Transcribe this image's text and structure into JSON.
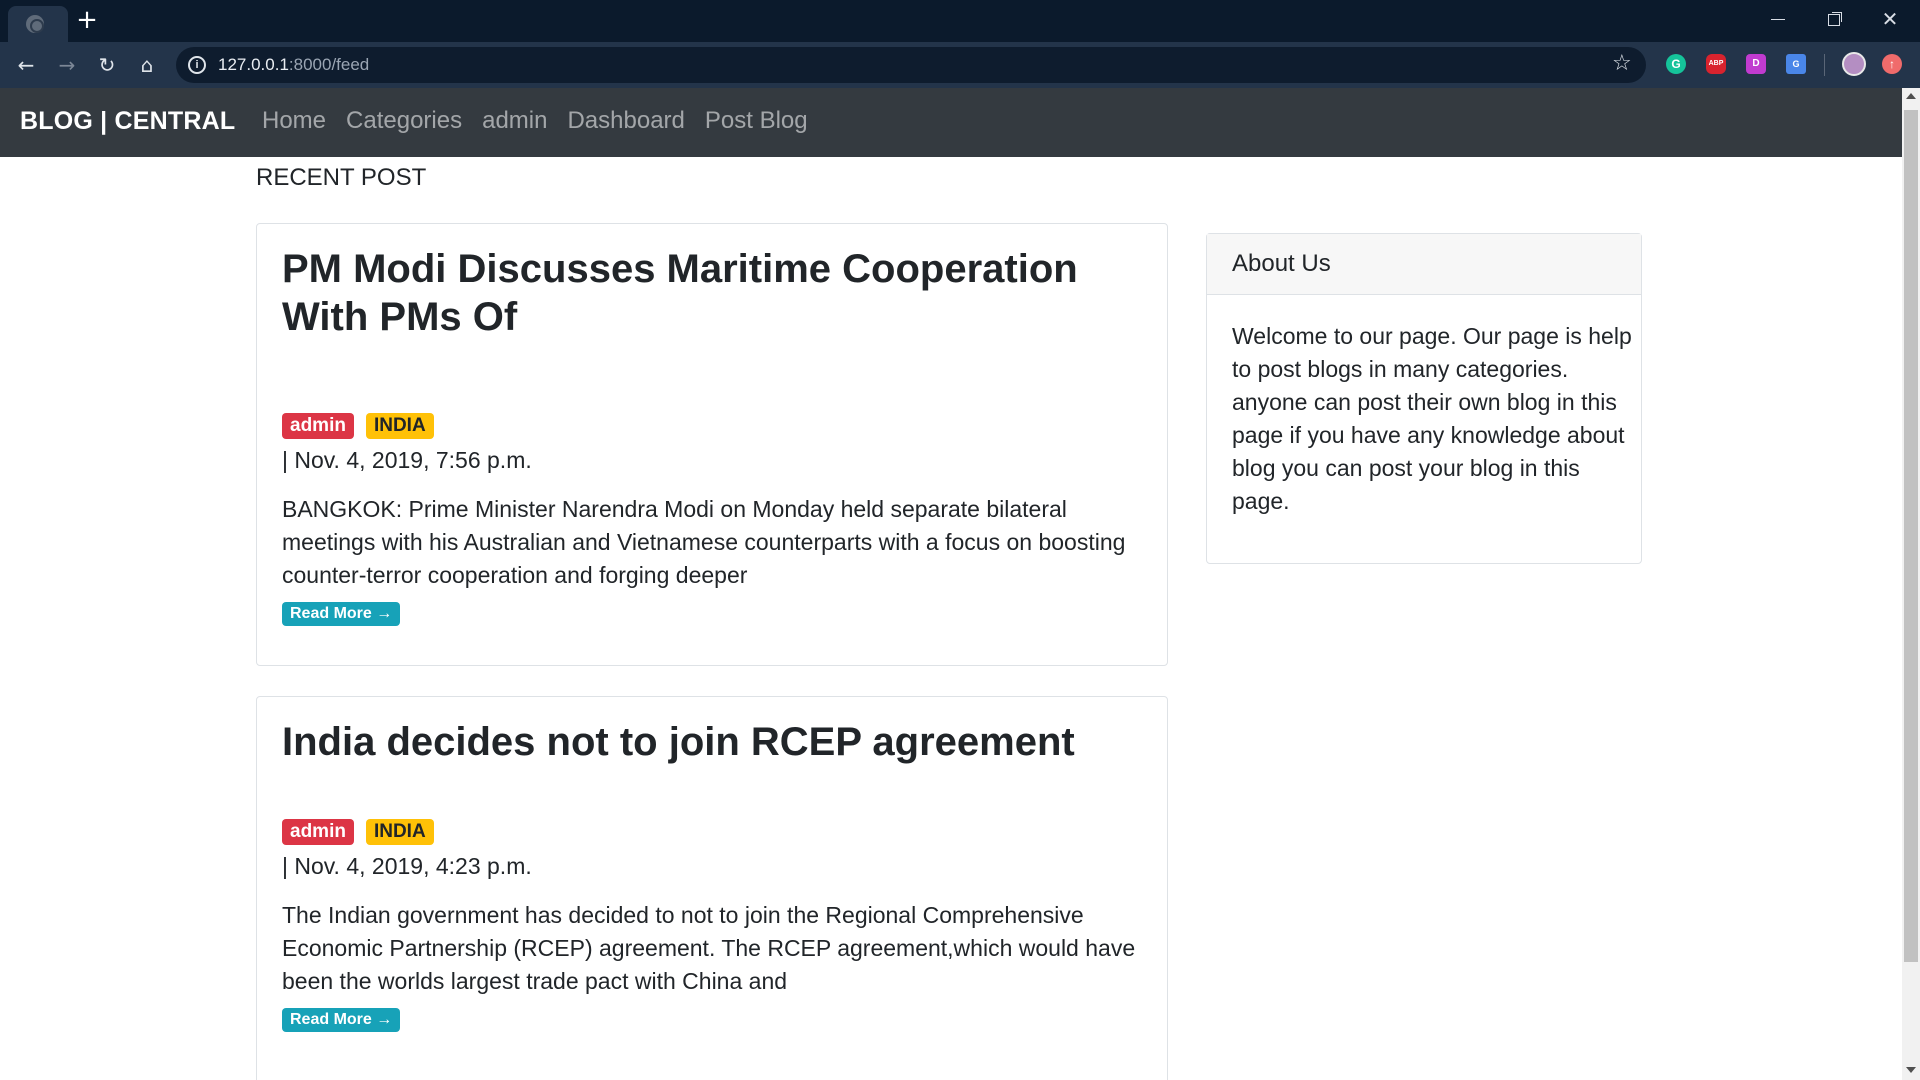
{
  "browser": {
    "new_tab": "+",
    "url_host": "127.0.0.1",
    "url_path": ":8000/feed",
    "info_icon": "i",
    "bookmark_icon": "☆",
    "extensions": {
      "grammarly": "G",
      "adblock": "ABP",
      "dark": "D",
      "translate": "G",
      "update": "↑"
    },
    "window": {
      "close": "✕"
    },
    "nav": {
      "back": "←",
      "forward": "→",
      "reload": "↻",
      "home": "⌂"
    }
  },
  "navbar": {
    "brand": "BLOG | CENTRAL",
    "links": [
      "Home",
      "Categories",
      "admin",
      "Dashboard",
      "Post Blog"
    ]
  },
  "main": {
    "section_title": "RECENT POST",
    "posts": [
      {
        "title": "PM Modi Discusses Maritime Cooperation With PMs Of",
        "author": "admin",
        "category": "INDIA",
        "date": "| Nov. 4, 2019, 7:56 p.m.",
        "excerpt": "BANGKOK: Prime Minister Narendra Modi on Monday held separate bilateral meetings with his Australian and Vietnamese counterparts with a focus on boosting counter-terror cooperation and forging deeper",
        "read_more": "Read More →"
      },
      {
        "title": "India decides not to join RCEP agreement",
        "author": "admin",
        "category": "INDIA",
        "date": "| Nov. 4, 2019, 4:23 p.m.",
        "excerpt": "The Indian government has decided to not to join the Regional Comprehensive Economic Partnership (RCEP) agreement. The RCEP agreement,which would have been the worlds largest trade pact with China and",
        "read_more": "Read More →"
      }
    ]
  },
  "sidebar": {
    "title": "About Us",
    "text": "Welcome to our page. Our page is help to post blogs in many categories. anyone can post their own blog in this page if you have any knowledge about blog you can post your blog in this page."
  }
}
